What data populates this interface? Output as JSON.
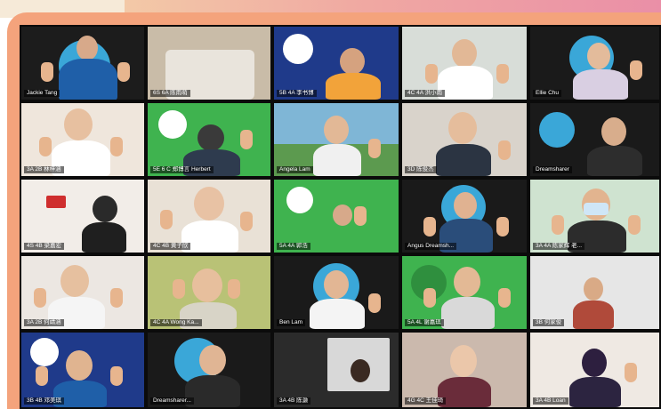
{
  "colors": {
    "frame_orange": "#f4a37c",
    "bar_pink": "#ea8fa7",
    "grid_bg": "#0b0b0b",
    "green_bg": "#3fb34f",
    "navy_bg": "#1f3a8a"
  },
  "participants": [
    {
      "name": "Jackie Tang"
    },
    {
      "name": "6S 6A 陈雨萌"
    },
    {
      "name": "5B 4A 李书博"
    },
    {
      "name": "4C 4A 洪小雨"
    },
    {
      "name": "Ellie Chu"
    },
    {
      "name": "3A 2B 林梓涵"
    },
    {
      "name": "5E 6 C 郑博言 Herbert"
    },
    {
      "name": "Angela Lam"
    },
    {
      "name": "3D 陈俊杰"
    },
    {
      "name": "Dreamsharer"
    },
    {
      "name": "4S 4B 梁嘉宏"
    },
    {
      "name": "4C 4B 黄子欣"
    },
    {
      "name": "5A 4A 郭浩"
    },
    {
      "name": "Angus Dreamsh..."
    },
    {
      "name": "3A 4A 陈家辉 老..."
    },
    {
      "name": "3A 2B 何靖涵"
    },
    {
      "name": "4C 4A Wong Ka..."
    },
    {
      "name": "Ben Lam"
    },
    {
      "name": "5A 4L 谢嘉琪"
    },
    {
      "name": "3B 何家俊"
    },
    {
      "name": "3B 4B 邓美琪"
    },
    {
      "name": "Dreamsharer..."
    },
    {
      "name": "3A 4B 陈灏"
    },
    {
      "name": "4G 4C 王佳琦"
    },
    {
      "name": "3A 4B Loan"
    }
  ]
}
